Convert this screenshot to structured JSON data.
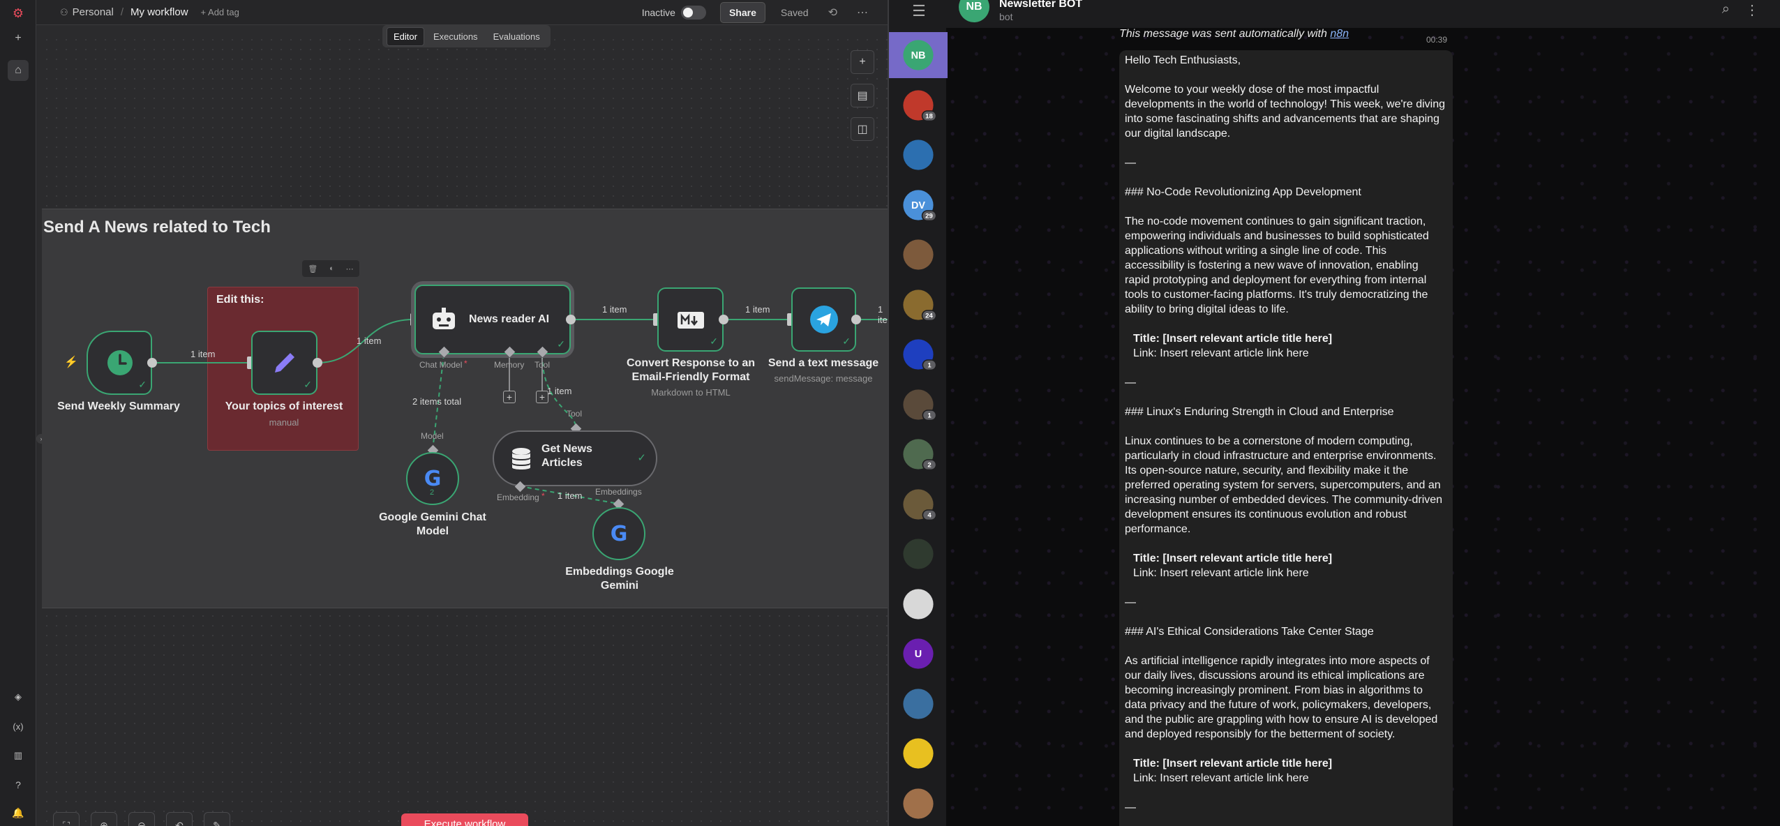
{
  "n8n": {
    "breadcrumb": {
      "project": "Personal",
      "workflow": "My workflow",
      "add_tag": "+ Add tag"
    },
    "status_label": "Inactive",
    "share_label": "Share",
    "saved_label": "Saved",
    "tabs": [
      "Editor",
      "Executions",
      "Evaluations"
    ],
    "sticky_title": "Send A News related to Tech",
    "edit_title": "Edit this:",
    "nodes": {
      "trigger": {
        "label": "Send Weekly Summary"
      },
      "topics": {
        "label": "Your topics of interest",
        "sub": "manual"
      },
      "agent": {
        "label": "News reader AI"
      },
      "convert": {
        "label1": "Convert Response to an",
        "label2": "Email-Friendly Format",
        "sub": "Markdown to HTML"
      },
      "telegram": {
        "label": "Send a text message",
        "sub": "sendMessage: message"
      },
      "gemini": {
        "label1": "Google Gemini Chat",
        "label2": "Model",
        "count": "2"
      },
      "news": {
        "label1": "Get News",
        "label2": "Articles"
      },
      "embed": {
        "label1": "Embeddings Google",
        "label2": "Gemini"
      }
    },
    "edges": {
      "e1": "1 item",
      "e2": "1 item",
      "e3": "1 item",
      "e4": "1 item",
      "e5": "1 item",
      "e6": "1 item",
      "items_total": "2 items total"
    },
    "ports": {
      "chat_model": "Chat Model",
      "memory": "Memory",
      "tool": "Tool",
      "model": "Model",
      "tool2": "Tool",
      "embedding": "Embedding",
      "embeddings": "Embeddings"
    },
    "execute_label": "Execute workflow",
    "accent": "#ea4b5c",
    "success": "#3aa673"
  },
  "telegram": {
    "chat_name": "Newsletter BOT",
    "chat_status": "bot",
    "header_initials": "NB",
    "chats": [
      {
        "initials": "NB",
        "color": "#3aa673",
        "badge": ""
      },
      {
        "initials": "",
        "color": "#c0392b",
        "badge": "18"
      },
      {
        "initials": "",
        "color": "#2c6fb0",
        "badge": ""
      },
      {
        "initials": "DV",
        "color": "#4a90d9",
        "badge": "29"
      },
      {
        "initials": "",
        "color": "#7d5a3c",
        "badge": ""
      },
      {
        "initials": "",
        "color": "#8a6b2f",
        "badge": "24"
      },
      {
        "initials": "",
        "color": "#1e3fbf",
        "badge": "1"
      },
      {
        "initials": "",
        "color": "#5a4a3a",
        "badge": "1"
      },
      {
        "initials": "",
        "color": "#4f6a4f",
        "badge": "2"
      },
      {
        "initials": "",
        "color": "#6b5a3a",
        "badge": "4"
      },
      {
        "initials": "",
        "color": "#2f3a2f",
        "badge": ""
      },
      {
        "initials": "",
        "color": "#d8d8d8",
        "badge": ""
      },
      {
        "initials": "U",
        "color": "#6a1fb0",
        "badge": ""
      },
      {
        "initials": "",
        "color": "#3a6fa0",
        "badge": ""
      },
      {
        "initials": "",
        "color": "#e8c020",
        "badge": ""
      },
      {
        "initials": "",
        "color": "#a0704a",
        "badge": ""
      }
    ],
    "prev_message": "This message was sent automatically with",
    "prev_link": "n8n",
    "time": "00:39",
    "message": {
      "greeting": "Hello Tech Enthusiasts,",
      "intro": "Welcome to your weekly dose of the most impactful developments in the world of technology! This week, we're diving into some fascinating shifts and advancements that are shaping our digital landscape.",
      "sep": "—",
      "h1": "### No-Code Revolutionizing App Development",
      "p1": "The no-code movement continues to gain significant traction, empowering individuals and businesses to build sophisticated applications without writing a single line of code. This accessibility is fostering a new wave of innovation, enabling rapid prototyping and deployment for everything from internal tools to customer-facing platforms. It's truly democratizing the ability to bring digital ideas to life.",
      "h2": "### Linux's Enduring Strength in Cloud and Enterprise",
      "p2": "Linux continues to be a cornerstone of modern computing, particularly in cloud infrastructure and enterprise environments. Its open-source nature, security, and flexibility make it the preferred operating system for servers, supercomputers, and an increasing number of embedded devices. The community-driven development ensures its continuous evolution and robust performance.",
      "h3": "### AI's Ethical Considerations Take Center Stage",
      "p3": "As artificial intelligence rapidly integrates into more aspects of our daily lives, discussions around its ethical implications are becoming increasingly prominent. From bias in algorithms to data privacy and the future of work, policymakers, developers, and the public are grappling with how to ensure AI is developed and deployed responsibly for the betterment of society.",
      "title_line": "Title: [Insert relevant article title here]",
      "link_line": "Link: Insert relevant article link here"
    }
  }
}
